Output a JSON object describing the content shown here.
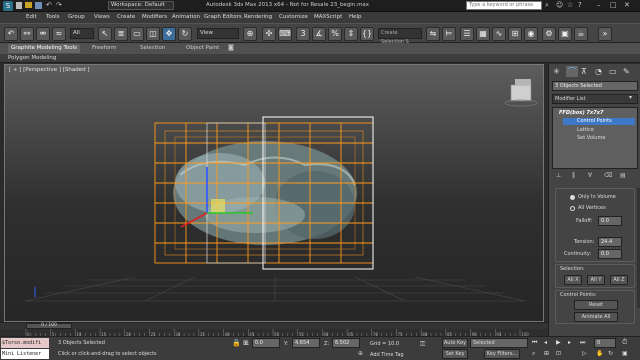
{
  "title": "Autodesk 3ds Max  2013 x64  - Not for Resale   23_begin.max",
  "workspace_label": "Workspace: Default",
  "search_placeholder": "Type a keyword or phrase",
  "menu": [
    "Edit",
    "Tools",
    "Group",
    "Views",
    "Create",
    "Modifiers",
    "Animation",
    "Graph Editors",
    "Rendering",
    "Customize",
    "MAXScript",
    "Help"
  ],
  "toolbar": {
    "filter_value": "All",
    "view_value": "View",
    "selection_set_placeholder": "Create Selection S"
  },
  "ribbon": {
    "tabs": [
      "Graphite Modeling Tools",
      "Freeform",
      "Selection",
      "Object Paint"
    ],
    "sub_label": "Polygon Modeling"
  },
  "viewport": {
    "label": "[ + ] [Perspective ] [Shaded ]"
  },
  "command_panel": {
    "selection_info": "3 Objects Selected",
    "modifier_list_label": "Modifier List",
    "stack": [
      {
        "label": "FFD(box) 7x7x7",
        "expanded": true
      },
      {
        "label": "Control Points",
        "selected": true
      },
      {
        "label": "Lattice"
      },
      {
        "label": "Set Volume"
      }
    ],
    "options": {
      "only_in_volume": "Only In Volume",
      "all_vertices": "All Vertices",
      "falloff_label": "Falloff:",
      "falloff_value": "0.0",
      "tension_label": "Tension:",
      "tension_value": "24.4",
      "continuity_label": "Continuity:",
      "continuity_value": "0.0"
    },
    "selection_group": {
      "title": "Selection:",
      "all_x": "All X",
      "all_y": "All Y",
      "all_z": "All Z"
    },
    "control_points_group": {
      "title": "Control Points:",
      "reset": "Reset",
      "animate_all": "Animate All"
    }
  },
  "timeline": {
    "frame_display": "0 / 100",
    "ticks": [
      "0",
      "5",
      "10",
      "15",
      "20",
      "25",
      "30",
      "35",
      "40",
      "45",
      "50",
      "55",
      "60",
      "65",
      "70",
      "75",
      "80",
      "85",
      "90",
      "95",
      "100"
    ]
  },
  "status": {
    "script_listener": "$Torso.modifi",
    "mini_listener": "Mini Listener",
    "objects_selected": "3 Objects Selected",
    "prompt": "Click or click-and-drag to select objects",
    "x_label": "X:",
    "x_value": "0.0",
    "y_label": "Y:",
    "y_value": "4.654",
    "z_label": "Z:",
    "z_value": "6.502",
    "grid": "Grid = 10.0",
    "add_time_tag": "Add Time Tag",
    "auto_key": "Auto Key",
    "set_key": "Set Key",
    "selected_dropdown": "Selected",
    "key_filters": "Key Filters...",
    "current_frame": "0"
  }
}
